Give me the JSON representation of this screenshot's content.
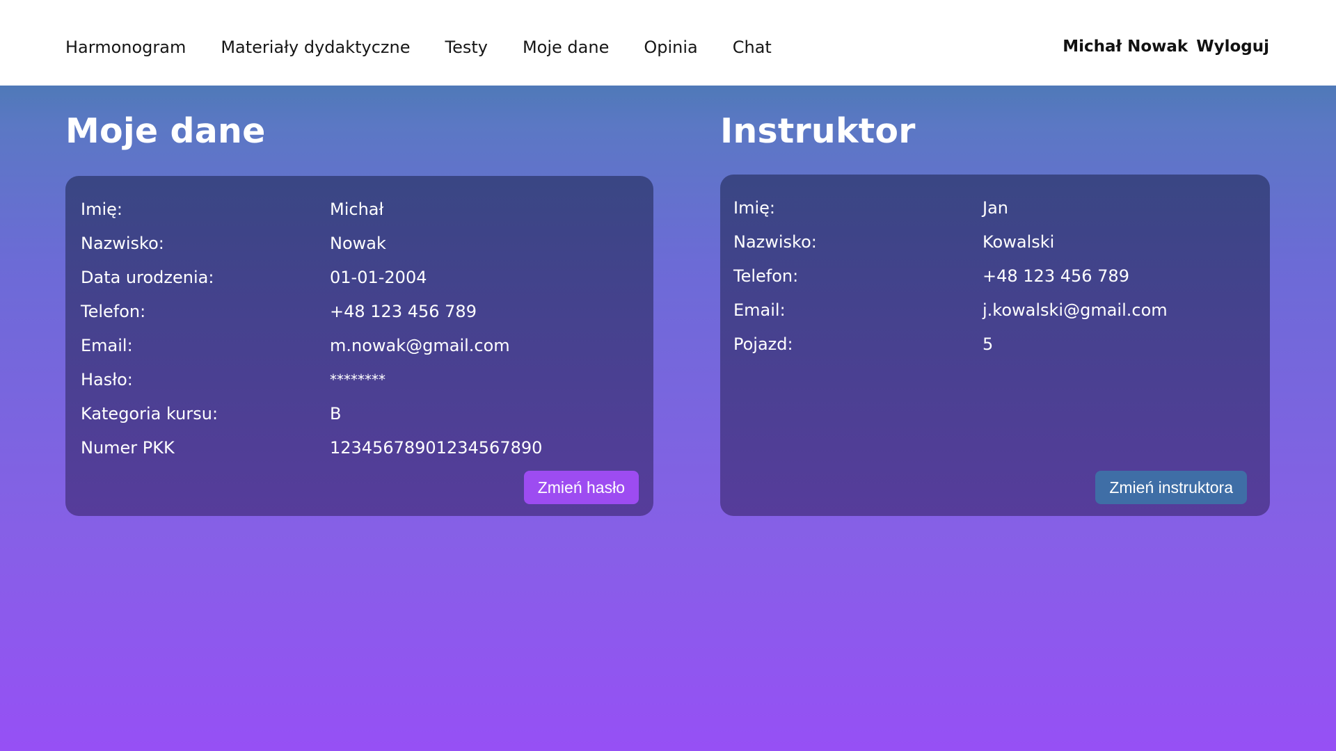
{
  "nav": {
    "items": [
      "Harmonogram",
      "Materiały dydaktyczne",
      "Testy",
      "Moje dane",
      "Opinia",
      "Chat"
    ],
    "user_name": "Michał Nowak",
    "logout": "Wyloguj"
  },
  "my_data": {
    "title": "Moje dane",
    "rows": [
      {
        "label": "Imię:",
        "value": "Michał"
      },
      {
        "label": "Nazwisko:",
        "value": "Nowak"
      },
      {
        "label": "Data urodzenia:",
        "value": "01-01-2004"
      },
      {
        "label": "Telefon:",
        "value": "+48 123 456 789"
      },
      {
        "label": "Email:",
        "value": "m.nowak@gmail.com"
      },
      {
        "label": "Hasło:",
        "value": "********"
      },
      {
        "label": "Kategoria kursu:",
        "value": "B"
      },
      {
        "label": "Numer PKK",
        "value": "12345678901234567890"
      }
    ],
    "button": "Zmień hasło"
  },
  "instructor": {
    "title": "Instruktor",
    "rows": [
      {
        "label": "Imię:",
        "value": "Jan"
      },
      {
        "label": "Nazwisko:",
        "value": "Kowalski"
      },
      {
        "label": "Telefon:",
        "value": "+48 123 456 789"
      },
      {
        "label": "Email:",
        "value": "j.kowalski@gmail.com"
      },
      {
        "label": "Pojazd:",
        "value": "5"
      }
    ],
    "button": "Zmień instruktora"
  },
  "colors": {
    "button_password": "#9d4cf1",
    "button_instructor": "#3f6ea6",
    "background_top": "#4f79b8",
    "background_bottom": "#9650f5"
  }
}
